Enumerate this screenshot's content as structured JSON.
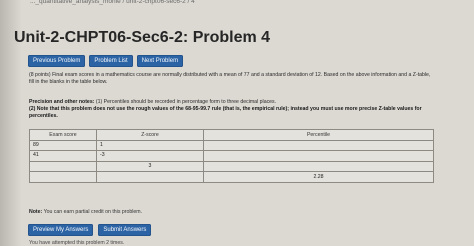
{
  "breadcrumb": "..._quantitative_analysis_monie / unit-2-chpt06-sec6-2 / 4",
  "page_title": "Unit-2-CHPT06-Sec6-2: Problem 4",
  "nav": {
    "previous": "Previous Problem",
    "list": "Problem List",
    "next": "Next Problem"
  },
  "problem": {
    "intro": "(8 points) Final exam scores in a mathematics course are normally distributed with a mean of 77 and a standard deviation of 12. Based on the above information and a Z-table, fill in the blanks in the table below.",
    "precision_label": "Precision and other notes:",
    "precision_line1": " (1) Percentiles should be recorded in percentage form to three decimal places.",
    "precision_line2": "(2) Note that this problem does not use the rough values of the 68-95-99.7 rule (that is, the empirical rule); instead you must use more precise Z-table values for percentiles."
  },
  "table": {
    "headers": [
      "Exam score",
      "Z-score",
      "Percentile"
    ],
    "rows": [
      [
        "89",
        "1",
        ""
      ],
      [
        "41",
        "-3",
        ""
      ],
      [
        "",
        "3",
        ""
      ],
      [
        "",
        "",
        "2.28"
      ]
    ]
  },
  "note_label": "Note:",
  "note_text": " You can earn partial credit on this problem.",
  "actions": {
    "preview": "Preview My Answers",
    "submit": "Submit Answers"
  },
  "attempts_text": "You have attempted this problem 2 times."
}
